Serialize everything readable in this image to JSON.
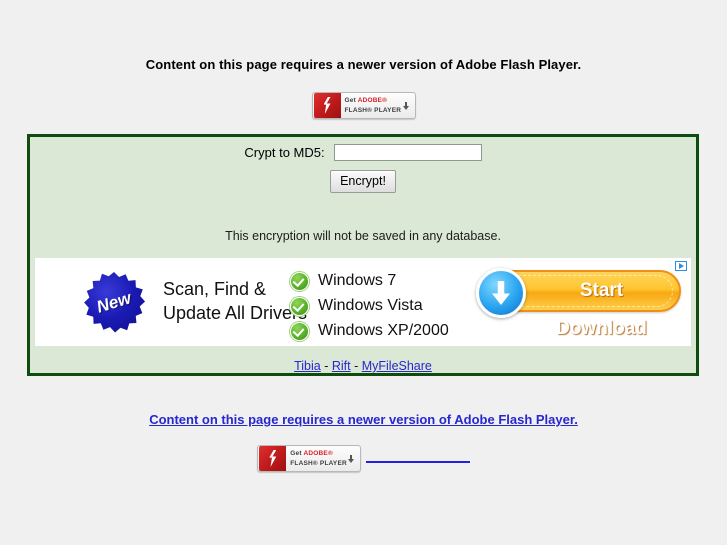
{
  "page": {
    "background_color": "#f0f0f0"
  },
  "flash_notice_top": "Content on this page requires a newer version of Adobe Flash Player.",
  "flash_notice_bottom": "Content on this page requires a newer version of Adobe Flash Player.",
  "adobe_badge": {
    "get_word": "Get",
    "adobe_word": "ADOBE®",
    "player_words": "FLASH® PLAYER",
    "arrow_icon": "download-arrow-icon",
    "logo_icon": "flash-logo-icon"
  },
  "form": {
    "label": "Crypt to MD5:",
    "input_value": "",
    "input_placeholder": "",
    "submit_label": "Encrypt!",
    "note": "This encryption will not be saved in any database.",
    "box_border_color": "#0f4d0f",
    "box_background_color": "#dbe8d5"
  },
  "ad": {
    "adchoices_icon": "adchoices-icon",
    "burst_label": "New",
    "headline_line1": "Scan, Find &",
    "headline_line2": "Update All Drivers",
    "os_items": [
      {
        "label": "Windows 7",
        "icon": "green-check-icon"
      },
      {
        "label": "Windows Vista",
        "icon": "green-check-icon"
      },
      {
        "label": "Windows XP/2000",
        "icon": "green-check-icon"
      }
    ],
    "cta_label": "Start Download",
    "cta_icon": "download-circle-icon",
    "accent_color": "#f8a811",
    "burst_color": "#1b1bb5",
    "check_color": "#5cb22b"
  },
  "site_links": {
    "items": [
      {
        "label": "Tibia"
      },
      {
        "label": "Rift"
      },
      {
        "label": "MyFileShare"
      }
    ],
    "separator": " - ",
    "link_color": "#2727d0"
  }
}
